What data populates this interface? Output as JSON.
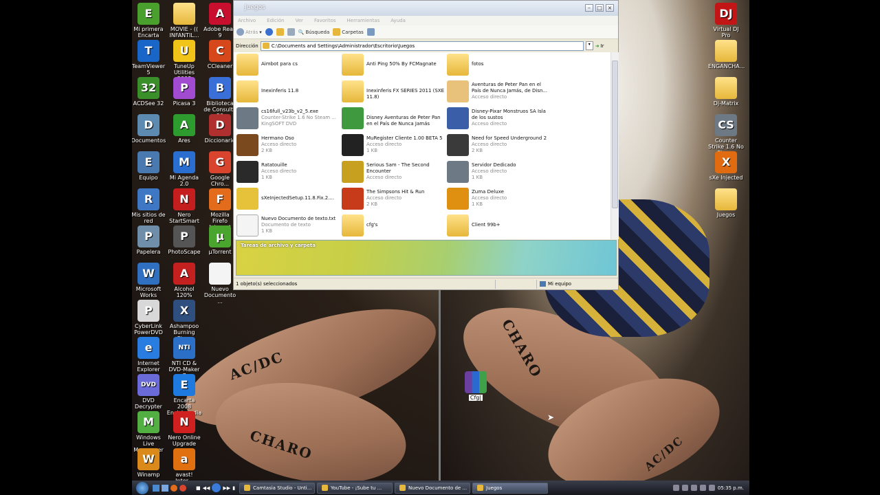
{
  "desktop": {
    "left_icons": [
      {
        "label": "Mi primera Encarta",
        "color": "#4aa02c",
        "glyph": "E"
      },
      {
        "label": "MOVIE - (( INFANTIL...",
        "color": "folder",
        "glyph": ""
      },
      {
        "label": "Adobe Read 9",
        "color": "#c8102e",
        "glyph": "A"
      },
      {
        "label": "TeamViewer 5",
        "color": "#1866c7",
        "glyph": "T"
      },
      {
        "label": "TuneUp Utilities 2008",
        "color": "#f0c419",
        "glyph": "U"
      },
      {
        "label": "CCleaner",
        "color": "#d7471c",
        "glyph": "C"
      },
      {
        "label": "ACDSee 32",
        "color": "#3a8f2b",
        "glyph": "32"
      },
      {
        "label": "Picasa 3",
        "color": "#a04bd0",
        "glyph": "P"
      },
      {
        "label": "Biblioteca de Consulta 20",
        "color": "#3a6fd8",
        "glyph": "B"
      },
      {
        "label": "Documentos",
        "color": "#5c8ab0",
        "glyph": "D"
      },
      {
        "label": "Ares",
        "color": "#2e9b2e",
        "glyph": "A"
      },
      {
        "label": "Diccionario",
        "color": "#b03030",
        "glyph": "D"
      },
      {
        "label": "Equipo",
        "color": "#4a78b0",
        "glyph": "E"
      },
      {
        "label": "Mi Agenda 2.0",
        "color": "#2a6fd0",
        "glyph": "M"
      },
      {
        "label": "Google Chro...",
        "color": "#d9442f",
        "glyph": "G"
      },
      {
        "label": "Mis sitios de red",
        "color": "#3e78c4",
        "glyph": "R"
      },
      {
        "label": "Nero StartSmart",
        "color": "#c41e1e",
        "glyph": "N"
      },
      {
        "label": "Mozilla Firefo Internet",
        "color": "#e36b1c",
        "glyph": "F"
      },
      {
        "label": "Papelera",
        "color": "#6f8eaa",
        "glyph": "P"
      },
      {
        "label": "PhotoScape",
        "color": "#555555",
        "glyph": "P"
      },
      {
        "label": "µTorrent",
        "color": "#4aa52e",
        "glyph": "µ"
      },
      {
        "label": "Microsoft Works",
        "color": "#3070c0",
        "glyph": "W"
      },
      {
        "label": "Alcohol 120%",
        "color": "#c42020",
        "glyph": "A"
      },
      {
        "label": "Nuevo Documento ...",
        "color": "#f4f4f4",
        "glyph": ""
      },
      {
        "label": "CyberLink PowerDVD",
        "color": "#d8d8d8",
        "glyph": "P"
      },
      {
        "label": "Ashampoo Burning Stu...",
        "color": "#2f4f7f",
        "glyph": "X"
      },
      {
        "label": "",
        "color": "",
        "glyph": ""
      },
      {
        "label": "Internet Explorer",
        "color": "#2a7de0",
        "glyph": "e"
      },
      {
        "label": "NTI CD & DVD-Maker 7",
        "color": "#2b6fc7",
        "glyph": "NTI"
      },
      {
        "label": "",
        "color": "",
        "glyph": ""
      },
      {
        "label": "DVD Decrypter",
        "color": "#6a6ad8",
        "glyph": "DVD"
      },
      {
        "label": "Encarta 2008 Enciclopedia",
        "color": "#1f7ae0",
        "glyph": "E"
      },
      {
        "label": "",
        "color": "",
        "glyph": ""
      },
      {
        "label": "Windows Live Messenger",
        "color": "#52b043",
        "glyph": "M"
      },
      {
        "label": "Nero Online Upgrade",
        "color": "#d02020",
        "glyph": "N"
      },
      {
        "label": "",
        "color": "",
        "glyph": ""
      },
      {
        "label": "Winamp",
        "color": "#d98a1a",
        "glyph": "W"
      },
      {
        "label": "avast! Inter...",
        "color": "#e07010",
        "glyph": "a"
      }
    ],
    "right_icons": [
      {
        "label": "Virtual DJ Pro",
        "color": "#c21616",
        "glyph": "DJ"
      },
      {
        "label": "ENGANCHA...",
        "color": "folder",
        "glyph": ""
      },
      {
        "label": "Dj-Matrix",
        "color": "folder",
        "glyph": ""
      },
      {
        "label": "Counter Strike 1.6 No Steam",
        "color": "#6d7a86",
        "glyph": "CS"
      },
      {
        "label": "sXe Injected",
        "color": "#e06b10",
        "glyph": "X"
      },
      {
        "label": "Juegos",
        "color": "folder",
        "glyph": ""
      }
    ],
    "winrar_file": {
      "label": "Cfg|"
    }
  },
  "window": {
    "title": "Juegos",
    "menu": [
      "Archivo",
      "Edición",
      "Ver",
      "Favoritos",
      "Herramientas",
      "Ayuda"
    ],
    "toolbar": {
      "back": "Atrás",
      "search": "Búsqueda",
      "folders": "Carpetas"
    },
    "address_label": "Dirección",
    "address_value": "C:\\Documents and Settings\\Administrador\\Escritorio\\Juegos",
    "go_label": "Ir",
    "tasks_header": "Tareas de archivo y carpeta",
    "status_left": "1 objeto(s) seleccionados",
    "status_right": "Mi equipo",
    "items": [
      {
        "name": "Aimbot para cs",
        "sub1": "",
        "sub2": "",
        "color": "folder"
      },
      {
        "name": "Anti Ping 50% By FCMagnate",
        "sub1": "",
        "sub2": "",
        "color": "folder"
      },
      {
        "name": "fotos",
        "sub1": "",
        "sub2": "",
        "color": "folder"
      },
      {
        "name": "Inexinferis 11.8",
        "sub1": "",
        "sub2": "",
        "color": "folder"
      },
      {
        "name": "Inexinferis FX SERIES 2011 (SXE 11.8)",
        "sub1": "",
        "sub2": "",
        "color": "folder"
      },
      {
        "name": "Aventuras de Peter Pan en el País de Nunca Jamás, de Disn...",
        "sub1": "Acceso directo",
        "sub2": "",
        "color": "#e8c27a"
      },
      {
        "name": "cs16full_v23b_v2_5.exe",
        "sub1": "Counter-Strike 1.6 No Steam ...",
        "sub2": "KingSOFT DVD",
        "color": "#6d7a86"
      },
      {
        "name": "Disney Aventuras de Peter Pan en el País de Nunca Jamás",
        "sub1": "",
        "sub2": "",
        "color": "#3f9a3f"
      },
      {
        "name": "Disney-Pixar Monstruos SA Isla de los sustos",
        "sub1": "Acceso directo",
        "sub2": "",
        "color": "#3a5fa8"
      },
      {
        "name": "Hermano Oso",
        "sub1": "Acceso directo",
        "sub2": "2 KB",
        "color": "#7a4a1e"
      },
      {
        "name": "MuRegister Cliente 1.00 BETA 5",
        "sub1": "Acceso directo",
        "sub2": "1 KB",
        "color": "#222222"
      },
      {
        "name": "Need for Speed Underground 2",
        "sub1": "Acceso directo",
        "sub2": "2 KB",
        "color": "#3a3a3a"
      },
      {
        "name": "Ratatouille",
        "sub1": "Acceso directo",
        "sub2": "1 KB",
        "color": "#2a2a2a"
      },
      {
        "name": "Serious Sam - The Second Encounter",
        "sub1": "Acceso directo",
        "sub2": "",
        "color": "#c8a020"
      },
      {
        "name": "Servidor Dedicado",
        "sub1": "Acceso directo",
        "sub2": "1 KB",
        "color": "#6d7a86"
      },
      {
        "name": "sXeInjectedSetup.11.8.Fix.2....",
        "sub1": "",
        "sub2": "",
        "color": "#e6c23a"
      },
      {
        "name": "The Simpsons Hit & Run",
        "sub1": "Acceso directo",
        "sub2": "2 KB",
        "color": "#c73a1a"
      },
      {
        "name": "Zuma Deluxe",
        "sub1": "Acceso directo",
        "sub2": "1 KB",
        "color": "#e09010"
      },
      {
        "name": "Nuevo Documento de texto.txt",
        "sub1": "Documento de texto",
        "sub2": "1 KB",
        "color": "#f4f4f4"
      },
      {
        "name": "cfg's",
        "sub1": "",
        "sub2": "",
        "color": "folder"
      },
      {
        "name": "Client 99b+",
        "sub1": "",
        "sub2": "",
        "color": "folder"
      }
    ]
  },
  "taskbar": {
    "tasks": [
      {
        "label": "Camtasia Studio - Unti...",
        "active": false
      },
      {
        "label": "YouTube - ¡Sube tu ...",
        "active": false
      },
      {
        "label": "Nuevo Documento de ...",
        "active": false
      },
      {
        "label": "Juegos",
        "active": true
      }
    ],
    "clock": "05:35 p.m."
  },
  "wallpaper": {
    "tattoo_1": "AC/DC",
    "tattoo_2": "CHARO",
    "tattoo_3": "CHARO",
    "tattoo_4": "AC/DC"
  }
}
